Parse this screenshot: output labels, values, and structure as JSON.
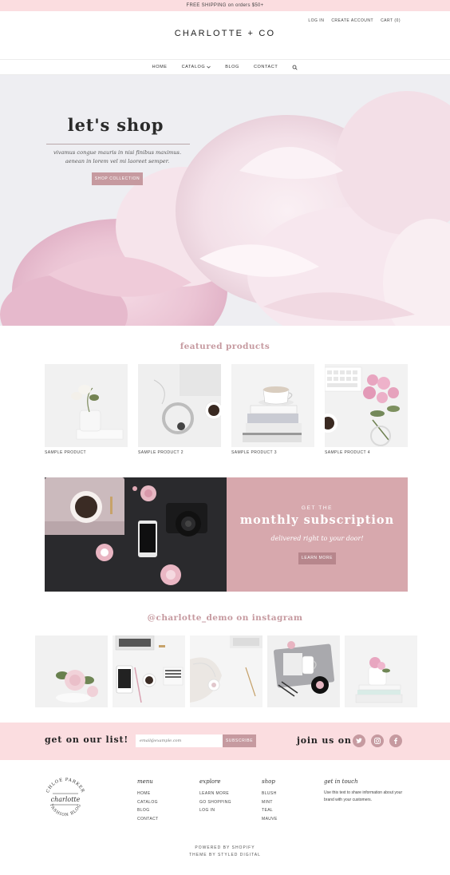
{
  "topbar": {
    "text": "FREE SHIPPING on orders $50+"
  },
  "header": {
    "login": "LOG IN",
    "create_account": "CREATE ACCOUNT",
    "cart": "CART (0)",
    "logo": "CHARLOTTE + CO"
  },
  "nav": {
    "home": "HOME",
    "catalog": "CATALOG",
    "blog": "BLOG",
    "contact": "CONTACT"
  },
  "hero": {
    "title": "let's shop",
    "subtitle_line1": "vivamus congue mauris in nisi finibus maximus.",
    "subtitle_line2": "aenean in lorem vel mi laoreet semper.",
    "button": "SHOP COLLECTION"
  },
  "featured": {
    "title": "featured products",
    "products": [
      {
        "label": "SAMPLE PRODUCT"
      },
      {
        "label": "SAMPLE PRODUCT 2"
      },
      {
        "label": "SAMPLE PRODUCT 3"
      },
      {
        "label": "SAMPLE PRODUCT 4"
      }
    ]
  },
  "subscription": {
    "kicker": "GET THE",
    "title": "monthly subscription",
    "tagline": "delivered right to your door!",
    "button": "LEARN MORE"
  },
  "instagram": {
    "title": "@charlotte_demo on instagram"
  },
  "newsletter": {
    "title": "get on our list!",
    "placeholder": "email@example.com",
    "button": "SUBSCRIBE",
    "join": "join us on"
  },
  "footer": {
    "badge": {
      "top": "CHLOE PARKER",
      "script": "charlotte",
      "bottom": "FASHION BLOG"
    },
    "menu": {
      "heading": "menu",
      "links": [
        "HOME",
        "CATALOG",
        "BLOG",
        "CONTACT"
      ]
    },
    "explore": {
      "heading": "explore",
      "links": [
        "LEARN MORE",
        "GO SHOPPING",
        "LOG IN"
      ]
    },
    "shop": {
      "heading": "shop",
      "links": [
        "BLUSH",
        "MINT",
        "TEAL",
        "MAUVE"
      ]
    },
    "touch": {
      "heading": "get in touch",
      "text": "Use this text to share information about your brand with your customers."
    },
    "powered": "POWERED BY SHOPIFY",
    "theme": "THEME BY STYLED DIGITAL"
  },
  "colors": {
    "accent": "#c69aa0",
    "blush": "#fbdde0",
    "banner": "#d7a8ad",
    "dark": "#2b2b2e"
  },
  "icons": [
    "search-icon",
    "chevron-down-icon",
    "twitter-icon",
    "instagram-icon",
    "facebook-icon"
  ]
}
